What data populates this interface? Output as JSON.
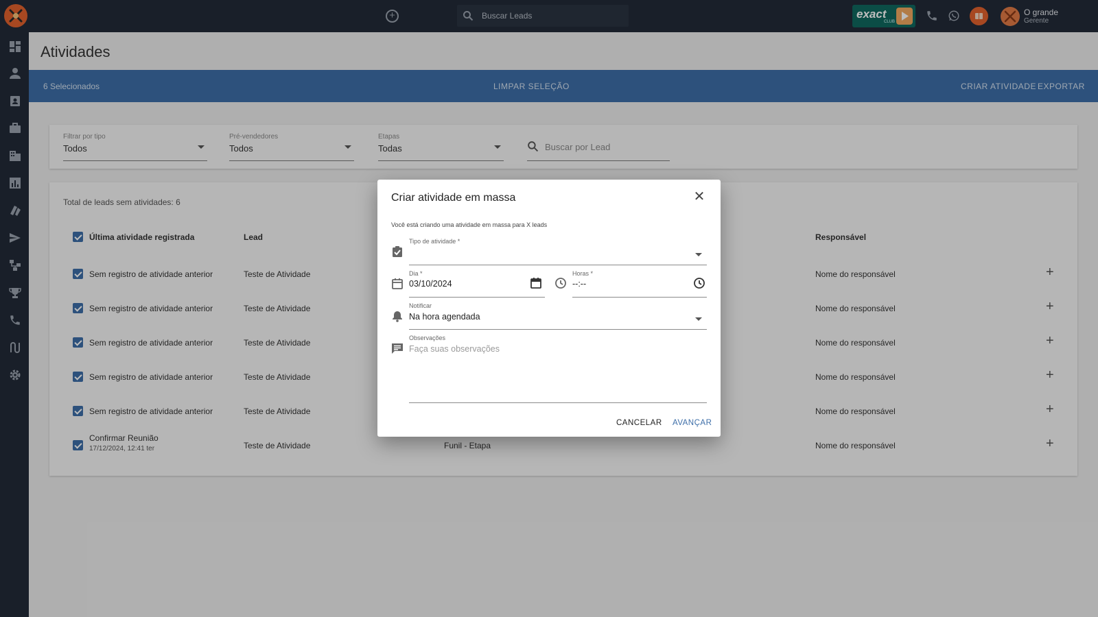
{
  "topbar": {
    "search_placeholder": "Buscar Leads",
    "brand": "exact",
    "brand_sub": "CLUB",
    "user_name": "O grande",
    "user_role": "Gerente"
  },
  "page": {
    "title": "Atividades"
  },
  "selection": {
    "count_label": "6 Selecionados",
    "clear_label": "LIMPAR SELEÇÃO",
    "create_label": "CRIAR ATIVIDADE",
    "export_label": "EXPORTAR"
  },
  "filters": {
    "type": {
      "label": "Filtrar por tipo",
      "value": "Todos"
    },
    "presellers": {
      "label": "Pré-vendedores",
      "value": "Todos"
    },
    "stages": {
      "label": "Etapas",
      "value": "Todas"
    },
    "lead_search_placeholder": "Buscar por Lead"
  },
  "table": {
    "total_label": "Total de leads sem atividades: 6",
    "headers": {
      "last_activity": "Última atividade registrada",
      "lead": "Lead",
      "owner": "Responsável"
    },
    "rows": [
      {
        "activity": "Sem registro de atividade anterior",
        "lead": "Teste de Atividade",
        "stage": "",
        "owner": "Nome do responsável"
      },
      {
        "activity": "Sem registro de atividade anterior",
        "lead": "Teste de Atividade",
        "stage": "",
        "owner": "Nome do responsável"
      },
      {
        "activity": "Sem registro de atividade anterior",
        "lead": "Teste de Atividade",
        "stage": "",
        "owner": "Nome do responsável"
      },
      {
        "activity": "Sem registro de atividade anterior",
        "lead": "Teste de Atividade",
        "stage": "",
        "owner": "Nome do responsável"
      },
      {
        "activity": "Sem registro de atividade anterior",
        "lead": "Teste de Atividade",
        "stage": "",
        "owner": "Nome do responsável"
      },
      {
        "activity": "Confirmar Reunião",
        "activity_sub": "17/12/2024, 12:41 ter",
        "lead": "Teste de Atividade",
        "stage": "Funil - Etapa",
        "owner": "Nome do responsável"
      }
    ]
  },
  "modal": {
    "title": "Criar atividade em massa",
    "description": "Você está criando uma atividade em massa para X leads",
    "type_label": "Tipo de atividade *",
    "type_value": "",
    "day_label": "Dia *",
    "day_value": "03/10/2024",
    "hours_label": "Horas *",
    "hours_value": "--:--",
    "notify_label": "Notificar",
    "notify_value": "Na hora agendada",
    "notes_label": "Observações",
    "notes_placeholder": "Faça suas observações",
    "cancel_label": "CANCELAR",
    "next_label": "AVANÇAR",
    "accent": "#3d6ea8"
  }
}
